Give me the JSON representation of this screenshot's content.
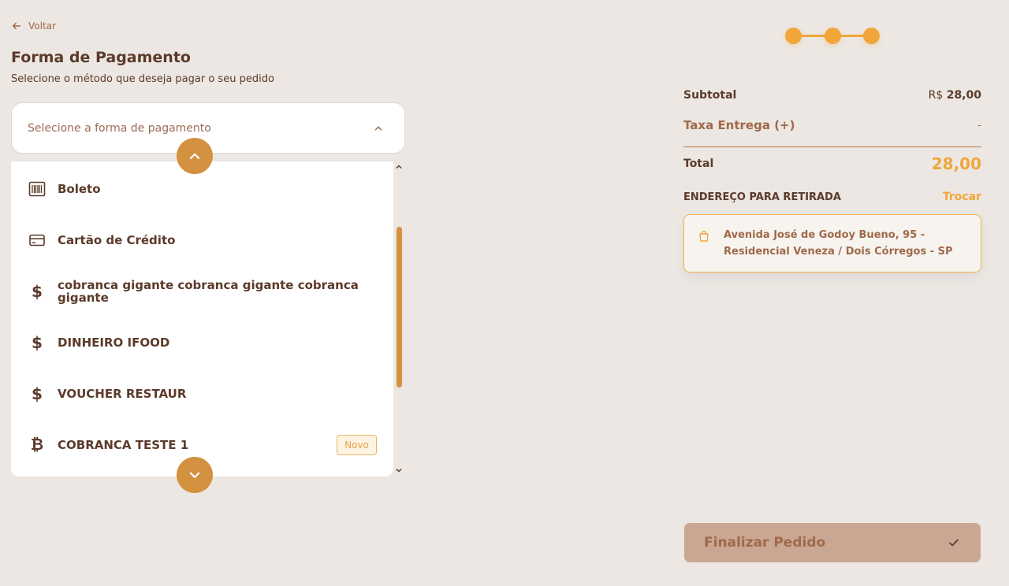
{
  "nav": {
    "back_label": "Voltar"
  },
  "page": {
    "title": "Forma de Pagamento",
    "subtitle": "Selecione o método que deseja pagar o seu pedido"
  },
  "select": {
    "placeholder": "Selecione a forma de pagamento"
  },
  "payment_methods": [
    {
      "label": "Boleto",
      "icon": "barcode-icon"
    },
    {
      "label": "Cartão de Crédito",
      "icon": "credit-card-icon"
    },
    {
      "label": "cobranca gigante cobranca gigante cobranca gigante",
      "icon": "dollar-icon"
    },
    {
      "label": "DINHEIRO IFOOD",
      "icon": "dollar-icon"
    },
    {
      "label": "VOUCHER RESTAUR",
      "icon": "dollar-icon"
    },
    {
      "label": "COBRANCA TESTE 1",
      "icon": "bitcoin-icon",
      "badge": "Novo"
    }
  ],
  "stepper": {
    "steps": 3
  },
  "summary": {
    "subtotal_label": "Subtotal",
    "subtotal_currency": "R$",
    "subtotal_value": "28,00",
    "delivery_label": "Taxa Entrega (+)",
    "delivery_value": "-",
    "total_label": "Total",
    "total_value": "28,00"
  },
  "address": {
    "heading": "ENDEREÇO PARA RETIRADA",
    "change_label": "Trocar",
    "line1": "Avenida José de Godoy Bueno, 95 -",
    "line2": "Residencial Veneza / Dois Córregos - SP"
  },
  "finalize": {
    "label": "Finalizar Pedido"
  },
  "colors": {
    "background": "#ece7e2",
    "accent": "#f0a63a",
    "brown": "#5b3a2a",
    "muted_brown": "#a0694a",
    "button_disabled": "#c9a793"
  }
}
